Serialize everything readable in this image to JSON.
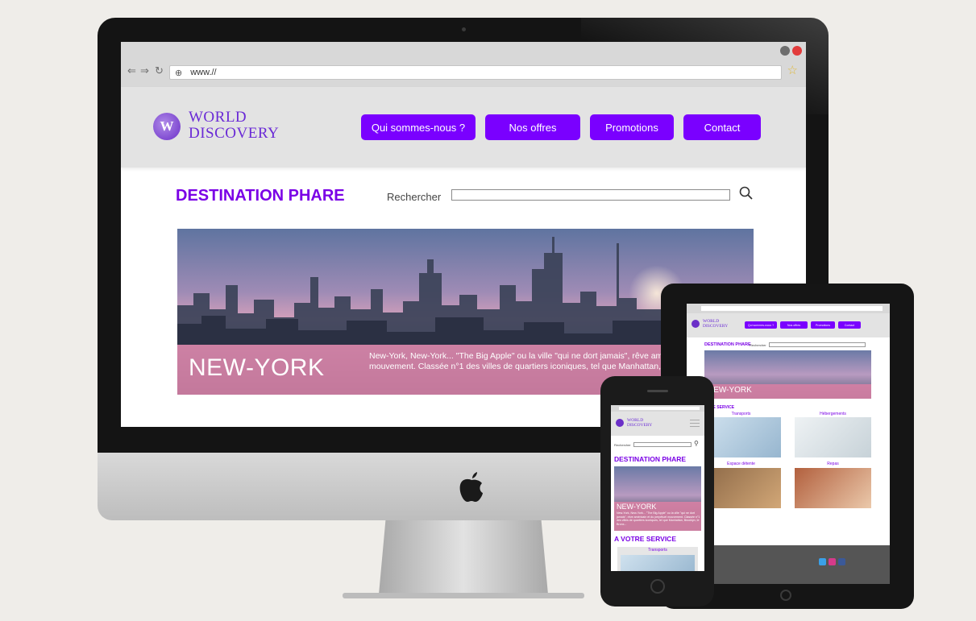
{
  "browser": {
    "url": "www.//"
  },
  "site": {
    "logo_line1": "WORLD",
    "logo_line2": "DISCOVERY",
    "logo_mark": "W",
    "menu": [
      {
        "label": "Qui sommes-nous ?"
      },
      {
        "label": "Nos offres"
      },
      {
        "label": "Promotions"
      },
      {
        "label": "Contact"
      }
    ],
    "section_title": "DESTINATION PHARE",
    "search_label": "Rechercher",
    "hero_city": "NEW-YORK",
    "hero_text": "New-York, New-York... \"The Big Apple\" ou la ville \"qui ne dort jamais\", rêve américain et du perpétuel mouvement. Classée n°1 des villes de quartiers iconiques, tel que Manhattan, Brooklyn, le Bronx...",
    "service_title": "A VOTRE SERVICE",
    "service_title_tablet": "OTRE SERVICE",
    "services": [
      {
        "label": "Transports"
      },
      {
        "label": "Hébergements"
      },
      {
        "label": "Espace détente"
      },
      {
        "label": "Repas"
      }
    ]
  },
  "colors": {
    "brand": "#7a00ff",
    "brand_text": "#7a00e6",
    "hero_band": "#d680a4",
    "header_bg": "#e3e3e3"
  },
  "icons": {
    "search": "search-icon",
    "star": "star-icon",
    "globe": "globe-icon",
    "apple": "apple-logo"
  }
}
